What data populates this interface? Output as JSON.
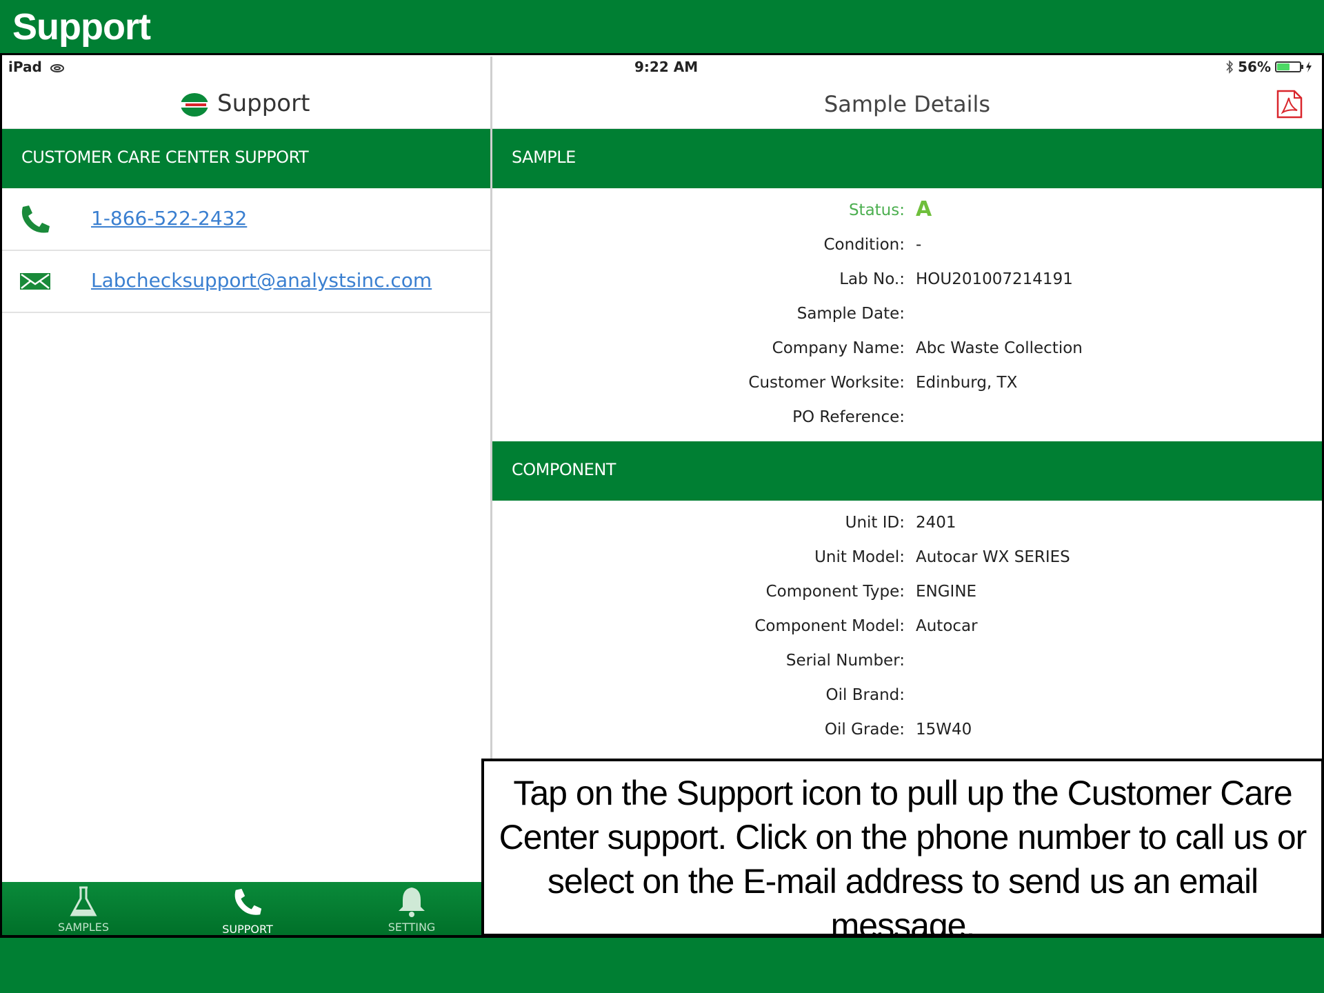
{
  "slide": {
    "title": "Support",
    "callout": "Tap on the Support icon to pull up the Customer Care Center support. Click on the phone number to call us or select on the E-mail address to send us an email message."
  },
  "statusbar": {
    "device": "iPad",
    "time": "9:22 AM",
    "battery_label": "56%",
    "battery_level": 0.56
  },
  "master": {
    "title": "Support",
    "section_header": "CUSTOMER CARE CENTER SUPPORT",
    "phone": "1-866-522-2432",
    "email": "Labchecksupport@analystsinc.com"
  },
  "tabs": [
    {
      "label": "SAMPLES",
      "icon": "flask-icon"
    },
    {
      "label": "SUPPORT",
      "icon": "phone-icon"
    },
    {
      "label": "SETTING",
      "icon": "bell-icon"
    }
  ],
  "detail": {
    "title": "Sample Details",
    "sample_header": "SAMPLE",
    "component_header": "COMPONENT",
    "sample_fields": [
      {
        "label": "Status:",
        "value": "A"
      },
      {
        "label": "Condition:",
        "value": "-"
      },
      {
        "label": "Lab No.:",
        "value": "HOU201007214191"
      },
      {
        "label": "Sample Date:",
        "value": ""
      },
      {
        "label": "Company Name:",
        "value": "Abc Waste Collection"
      },
      {
        "label": "Customer Worksite:",
        "value": "Edinburg, TX"
      },
      {
        "label": "PO Reference:",
        "value": ""
      }
    ],
    "component_fields": [
      {
        "label": "Unit ID:",
        "value": "2401"
      },
      {
        "label": "Unit Model:",
        "value": "Autocar WX SERIES"
      },
      {
        "label": "Component Type:",
        "value": "ENGINE"
      },
      {
        "label": "Component Model:",
        "value": "Autocar"
      },
      {
        "label": "Serial Number:",
        "value": ""
      },
      {
        "label": "Oil Brand:",
        "value": ""
      },
      {
        "label": "Oil Grade:",
        "value": "15W40"
      }
    ]
  },
  "colors": {
    "brand_green": "#007f33",
    "link_blue": "#3a7fd0",
    "status_green": "#6fbf3c",
    "pdf_red": "#d9262c"
  }
}
